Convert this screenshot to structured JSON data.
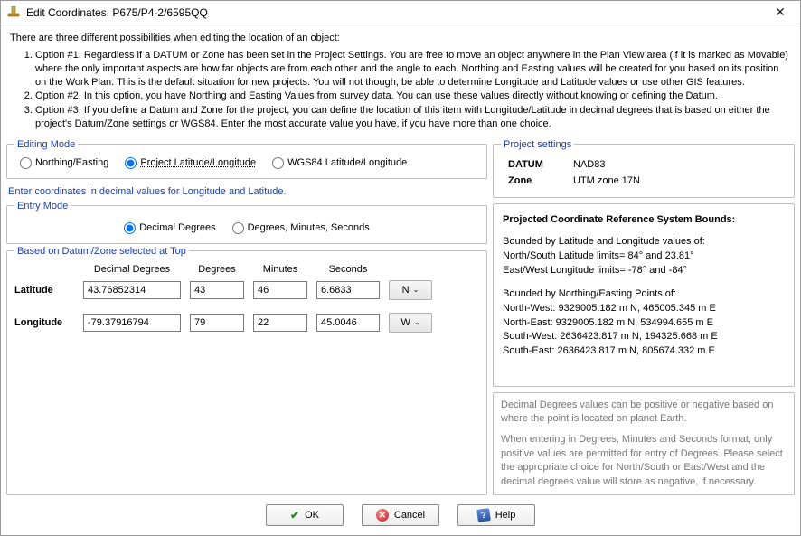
{
  "window": {
    "title": "Edit Coordinates: P675/P4-2/6595QQ"
  },
  "intro": {
    "lead": "There are three different possibilities when editing the location of an object:",
    "options": [
      "Option #1. Regardless if a DATUM or Zone has been set in the Project Settings. You are free to move an object anywhere in the Plan View area (if it is marked as Movable) where the only important aspects are how far objects are from each other and the angle to each. Northing and Easting values will be created for you based on its position on the Work Plan. This is the default situation for new projects. You will not though, be able to determine Longitude and Latitude values or use other GIS features.",
      "Option #2. In this option, you have Northing and Easting Values from survey data. You can use these values directly without knowing or defining the Datum.",
      "Option #3. If you define a Datum and Zone for the project, you can define the location of this item with Longitude/Latitude in decimal degrees that is based on either the project's Datum/Zone settings or WGS84. Enter the most accurate value you have, if you have more than one choice."
    ]
  },
  "editing_mode": {
    "legend": "Editing Mode",
    "ne": "Northing/Easting",
    "proj": "Project Latitude/Longitude",
    "wgs": "WGS84 Latitude/Longitude"
  },
  "instruction": "Enter coordinates in decimal values for Longitude and Latitude.",
  "entry_mode": {
    "legend": "Entry Mode",
    "dd": "Decimal Degrees",
    "dms": "Degrees, Minutes, Seconds"
  },
  "datum_zone": {
    "legend": "Based on Datum/Zone selected at Top",
    "headers": {
      "dd": "Decimal Degrees",
      "deg": "Degrees",
      "min": "Minutes",
      "sec": "Seconds"
    },
    "lat_label": "Latitude",
    "lon_label": "Longitude",
    "lat": {
      "dd": "43.76852314",
      "deg": "43",
      "min": "46",
      "sec": "6.6833",
      "hemi": "N"
    },
    "lon": {
      "dd": "-79.37916794",
      "deg": "79",
      "min": "22",
      "sec": "45.0046",
      "hemi": "W"
    }
  },
  "project_settings": {
    "legend": "Project settings",
    "datum_label": "DATUM",
    "datum_value": "NAD83",
    "zone_label": "Zone",
    "zone_value": "UTM zone 17N"
  },
  "bounds": {
    "title": "Projected Coordinate Reference System Bounds:",
    "l1": "Bounded by Latitude and Longitude values of:",
    "l2": "North/South Latitude limits= 84° and 23.81°",
    "l3": "East/West Longitude limits= -78° and -84°",
    "l4": "Bounded by Northing/Easting Points of:",
    "l5": "North-West: 9329005.182 m N, 465005.345 m E",
    "l6": "North-East: 9329005.182 m N, 534994.655 m E",
    "l7": "South-West: 2636423.817 m N, 194325.668 m E",
    "l8": "South-East: 2636423.817 m N, 805674.332 m E"
  },
  "note": {
    "p1": "Decimal Degrees values can be positive or negative based on where the point is located on planet Earth.",
    "p2": "When entering in Degrees, Minutes and Seconds format, only positive values are permitted for entry of Degrees. Please select the appropriate choice for North/South or East/West and the decimal degrees value will store as negative, if necessary."
  },
  "buttons": {
    "ok": "OK",
    "cancel": "Cancel",
    "help": "Help"
  }
}
